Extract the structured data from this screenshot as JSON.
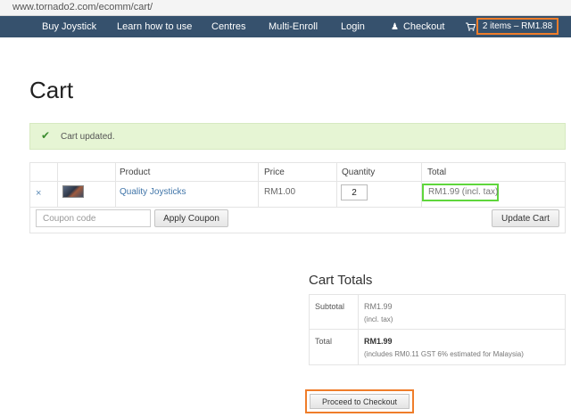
{
  "browser": {
    "url": "www.tornado2.com/ecomm/cart/"
  },
  "nav": {
    "items": [
      {
        "label": "Buy Joystick"
      },
      {
        "label": "Learn how to use"
      },
      {
        "label": "Centres"
      },
      {
        "label": "Multi-Enroll"
      },
      {
        "label": "Login"
      },
      {
        "label": "Checkout",
        "icon": "user-icon"
      }
    ],
    "cart": {
      "icon": "cart-icon",
      "label": "2 items – RM1.88"
    }
  },
  "page": {
    "title": "Cart"
  },
  "notice": {
    "icon": "checkmark-icon",
    "message": "Cart updated."
  },
  "cart_table": {
    "headers": {
      "product": "Product",
      "price": "Price",
      "quantity": "Quantity",
      "total": "Total"
    },
    "rows": [
      {
        "remove": "×",
        "product": "Quality Joysticks",
        "price": "RM1.00",
        "quantity": "2",
        "total": "RM1.99 (incl. tax)"
      }
    ],
    "coupon": {
      "placeholder": "Coupon code",
      "apply_label": "Apply Coupon"
    },
    "update_label": "Update Cart"
  },
  "totals": {
    "title": "Cart Totals",
    "subtotal": {
      "label": "Subtotal",
      "value": "RM1.99",
      "note": "(incl. tax)"
    },
    "total": {
      "label": "Total",
      "value": "RM1.99",
      "note": "(includes RM0.11 GST 6% estimated for Malaysia)"
    },
    "checkout_label": "Proceed to Checkout"
  },
  "colors": {
    "nav_bg": "#36516d",
    "highlight_orange": "#ef7d2a",
    "highlight_green": "#5fd63c",
    "notice_bg": "#e6f5d4",
    "link": "#3f74a8"
  }
}
